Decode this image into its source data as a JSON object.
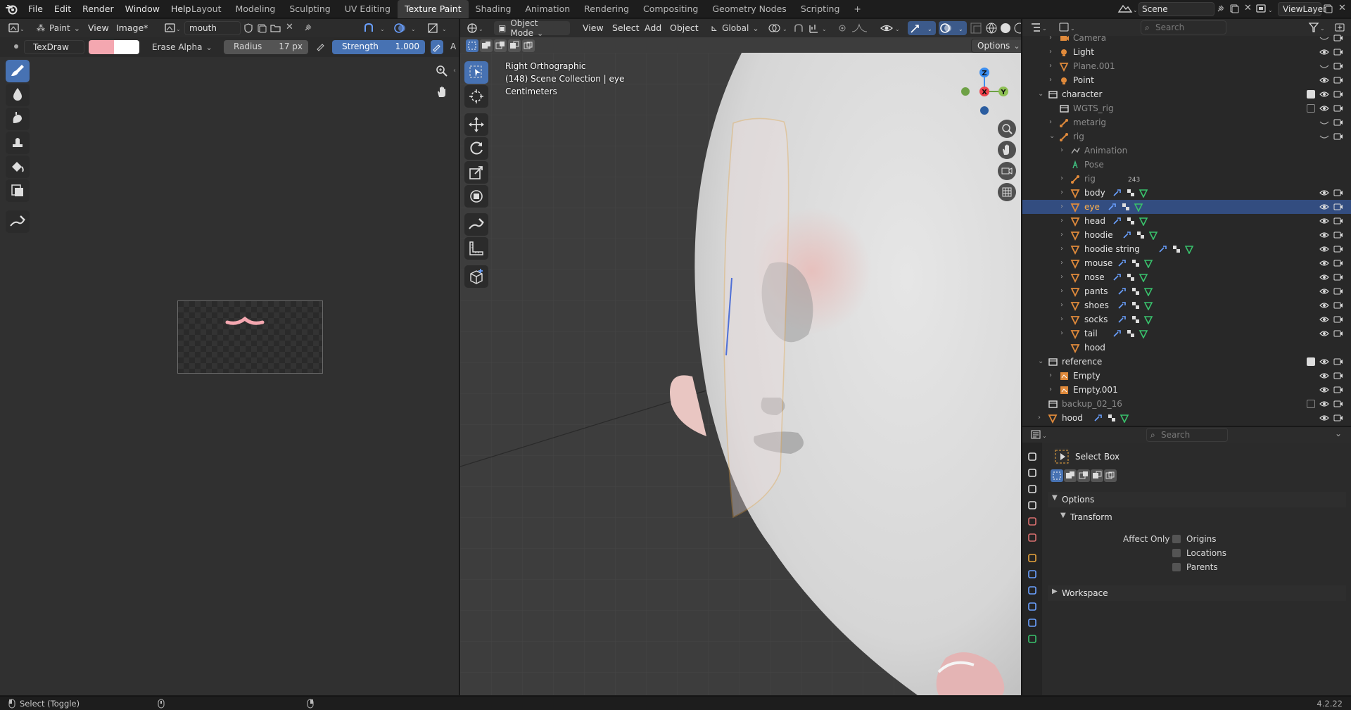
{
  "topbar": {
    "menus": [
      "File",
      "Edit",
      "Render",
      "Window",
      "Help"
    ],
    "workspaces": [
      "Layout",
      "Modeling",
      "Sculpting",
      "UV Editing",
      "Texture Paint",
      "Shading",
      "Animation",
      "Rendering",
      "Compositing",
      "Geometry Nodes",
      "Scripting"
    ],
    "active_workspace": "Texture Paint",
    "add_tab": "+",
    "scene": "Scene",
    "view_layer": "ViewLayer"
  },
  "image_editor": {
    "mode": "Paint",
    "view_menu": "View",
    "image_menu": "Image*",
    "image_name": "mouth",
    "brush_name": "TexDraw",
    "brush_color": "#f4a7b0",
    "secondary_color": "#ffffff",
    "blend_mode": "Erase Alpha",
    "radius_label": "Radius",
    "radius_value": "17 px",
    "strength_label": "Strength",
    "strength_value": "1.000",
    "trailing_label": "A",
    "tools": [
      "draw-brush",
      "soften-brush",
      "smear-brush",
      "clone-brush",
      "fill-brush",
      "mask-brush",
      "annotate-tool"
    ]
  },
  "viewport": {
    "mode": "Object Mode",
    "menus": [
      "View",
      "Select",
      "Add",
      "Object"
    ],
    "orientation": "Global",
    "options_label": "Options",
    "overlay_line1": "Right Orthographic",
    "overlay_line2": "(148) Scene Collection | eye",
    "overlay_line3": "Centimeters",
    "gizmo": {
      "z": "Z",
      "x": "X",
      "y": "Y"
    },
    "tools": [
      "select-box",
      "cursor",
      "move",
      "rotate",
      "scale",
      "transform",
      "annotate",
      "measure",
      "add-cube"
    ]
  },
  "outliner": {
    "search_placeholder": "Search",
    "rows": [
      {
        "label": "Camera",
        "indent": 1,
        "type": "camera",
        "sel": false,
        "dim": true,
        "eye": "closed"
      },
      {
        "label": "Light",
        "indent": 1,
        "type": "light",
        "sel": false,
        "dim": false,
        "eye": "open"
      },
      {
        "label": "Plane.001",
        "indent": 1,
        "type": "mesh",
        "sel": false,
        "dim": true,
        "eye": "closed"
      },
      {
        "label": "Point",
        "indent": 1,
        "type": "light",
        "sel": false,
        "dim": false,
        "eye": "open"
      },
      {
        "label": "character",
        "indent": 0,
        "type": "collection",
        "sel": false,
        "dim": false,
        "eye": "open"
      },
      {
        "label": "WGTS_rig",
        "indent": 1,
        "type": "collection",
        "sel": false,
        "dim": true,
        "eye": "open"
      },
      {
        "label": "metarig",
        "indent": 1,
        "type": "armature",
        "sel": false,
        "dim": true,
        "eye": "closed"
      },
      {
        "label": "rig",
        "indent": 1,
        "type": "armature",
        "sel": false,
        "dim": true,
        "eye": "closed"
      },
      {
        "label": "Animation",
        "indent": 2,
        "type": "anim",
        "sel": false,
        "dim": true,
        "eye": "none"
      },
      {
        "label": "Pose",
        "indent": 2,
        "type": "pose",
        "sel": false,
        "dim": true,
        "eye": "none"
      },
      {
        "label": "rig",
        "indent": 2,
        "type": "armature",
        "sel": false,
        "dim": true,
        "eye": "none"
      },
      {
        "label": "body",
        "indent": 2,
        "type": "mesh",
        "sel": false,
        "dim": false,
        "eye": "open"
      },
      {
        "label": "eye",
        "indent": 2,
        "type": "mesh",
        "sel": true,
        "dim": false,
        "eye": "open"
      },
      {
        "label": "head",
        "indent": 2,
        "type": "mesh",
        "sel": false,
        "dim": false,
        "eye": "open"
      },
      {
        "label": "hoodie",
        "indent": 2,
        "type": "mesh",
        "sel": false,
        "dim": false,
        "eye": "open"
      },
      {
        "label": "hoodie string",
        "indent": 2,
        "type": "mesh",
        "sel": false,
        "dim": false,
        "eye": "open"
      },
      {
        "label": "mouse",
        "indent": 2,
        "type": "mesh",
        "sel": false,
        "dim": false,
        "eye": "open"
      },
      {
        "label": "nose",
        "indent": 2,
        "type": "mesh",
        "sel": false,
        "dim": false,
        "eye": "open"
      },
      {
        "label": "pants",
        "indent": 2,
        "type": "mesh",
        "sel": false,
        "dim": false,
        "eye": "open"
      },
      {
        "label": "shoes",
        "indent": 2,
        "type": "mesh",
        "sel": false,
        "dim": false,
        "eye": "open"
      },
      {
        "label": "socks",
        "indent": 2,
        "type": "mesh",
        "sel": false,
        "dim": false,
        "eye": "open"
      },
      {
        "label": "tail",
        "indent": 2,
        "type": "mesh",
        "sel": false,
        "dim": false,
        "eye": "open"
      },
      {
        "label": "hood",
        "indent": 2,
        "type": "mesh",
        "sel": false,
        "dim": false,
        "eye": "none"
      },
      {
        "label": "reference",
        "indent": 0,
        "type": "collection",
        "sel": false,
        "dim": false,
        "eye": "open"
      },
      {
        "label": "Empty",
        "indent": 1,
        "type": "empty",
        "sel": false,
        "dim": false,
        "eye": "open"
      },
      {
        "label": "Empty.001",
        "indent": 1,
        "type": "empty",
        "sel": false,
        "dim": false,
        "eye": "open"
      },
      {
        "label": "backup_02_16",
        "indent": 0,
        "type": "collection",
        "sel": false,
        "dim": true,
        "eye": "open"
      },
      {
        "label": "hood",
        "indent": 0,
        "type": "mesh",
        "sel": false,
        "dim": false,
        "eye": "open"
      }
    ],
    "rig_count": "243"
  },
  "properties": {
    "search_placeholder": "Search",
    "tool_name": "Select Box",
    "options_label": "Options",
    "transform_label": "Transform",
    "affect_only_label": "Affect Only",
    "checkboxes": [
      "Origins",
      "Locations",
      "Parents"
    ],
    "workspace_label": "Workspace"
  },
  "statusbar": {
    "hint": "Select (Toggle)",
    "version": "4.2.22"
  },
  "colors": {
    "accent": "#4772b3",
    "selection": "#334d80",
    "object_orange": "#e8a33d",
    "mesh_green": "#39c16c"
  }
}
